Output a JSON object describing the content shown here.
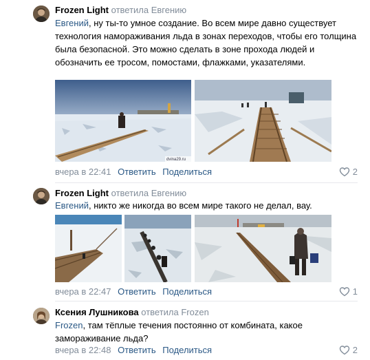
{
  "comments": [
    {
      "author": "Frozen Light",
      "replied_to": "ответила Евгению",
      "mention": "Евгений",
      "text": ", ну ты-то умное создание. Во всем мире давно существует технология намораживания льда в зонах переходов, чтобы его толщина была безопасной. Это можно сделать в зоне прохода людей и обозначить ее тросом, помостами, флажками, указателями.",
      "photo_watermark": "dvina29.ru",
      "date": "вчера в 22:41",
      "reply_label": "Ответить",
      "share_label": "Поделиться",
      "likes": "2"
    },
    {
      "author": "Frozen Light",
      "replied_to": "ответила Евгению",
      "mention": "Евгений",
      "text": ", никто же никогда во всем мире такого не делал, вау.",
      "date": "вчера в 22:47",
      "reply_label": "Ответить",
      "share_label": "Поделиться",
      "likes": "1"
    },
    {
      "author": "Ксения Лушникова",
      "replied_to": "ответила Frozen",
      "mention": "Frozen",
      "text": ", там тёплые течения постоянно от комбината, какое замораживание льда?",
      "date": "вчера в 22:48",
      "reply_label": "Ответить",
      "share_label": "Поделиться",
      "likes": "2"
    }
  ],
  "icons": {
    "like": "heart-outline-icon"
  },
  "colors": {
    "link": "#2a5885",
    "secondary": "#818c99",
    "divider": "#e7e8ec"
  }
}
